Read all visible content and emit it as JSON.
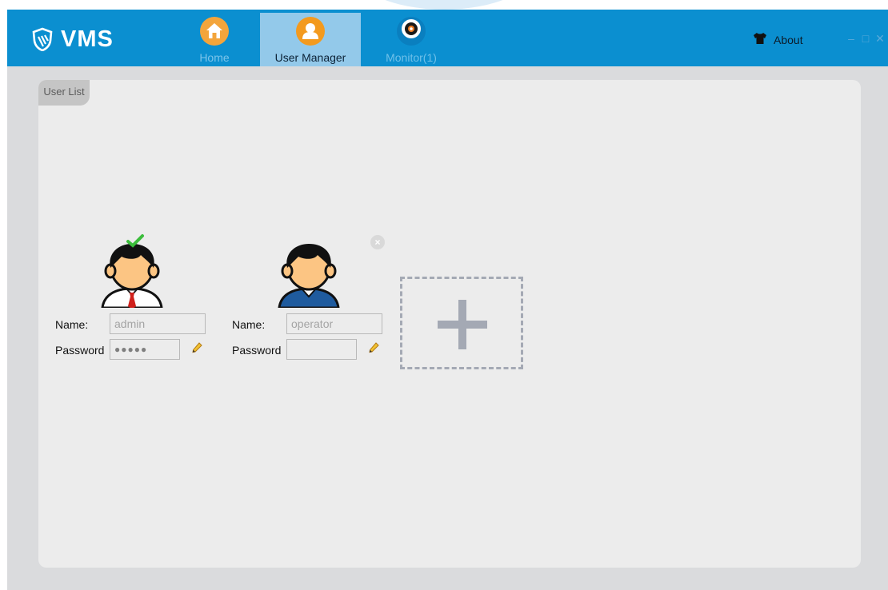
{
  "app": {
    "name": "VMS"
  },
  "tabs": [
    {
      "label": "Home",
      "icon": "home-icon",
      "active": false
    },
    {
      "label": "User Manager",
      "icon": "user-icon",
      "active": true
    },
    {
      "label": "Monitor(1)",
      "icon": "monitor-icon",
      "active": false
    }
  ],
  "header": {
    "about_label": "About",
    "about_icon": "shirt-icon"
  },
  "window_controls": {
    "minimize": "–",
    "maximize": "□",
    "close": "✕"
  },
  "panel": {
    "tab_label": "User List"
  },
  "users": [
    {
      "name_label": "Name:",
      "name_value": "admin",
      "password_label": "Password",
      "password_value": "●●●●●",
      "selected": true,
      "tie_color": "#d0201b"
    },
    {
      "name_label": "Name:",
      "name_value": "operator",
      "password_label": "Password",
      "password_value": "",
      "selected": false,
      "shirt_color": "#1f5b9e"
    }
  ],
  "add_user": {
    "icon": "plus-icon"
  },
  "colors": {
    "titlebar": "#0b8fd0",
    "active_tab": "#93c9ea",
    "home_icon": "#f3a53c",
    "user_icon": "#f39a1e",
    "panel": "#ececec",
    "checkmark": "#3bbd3b"
  }
}
